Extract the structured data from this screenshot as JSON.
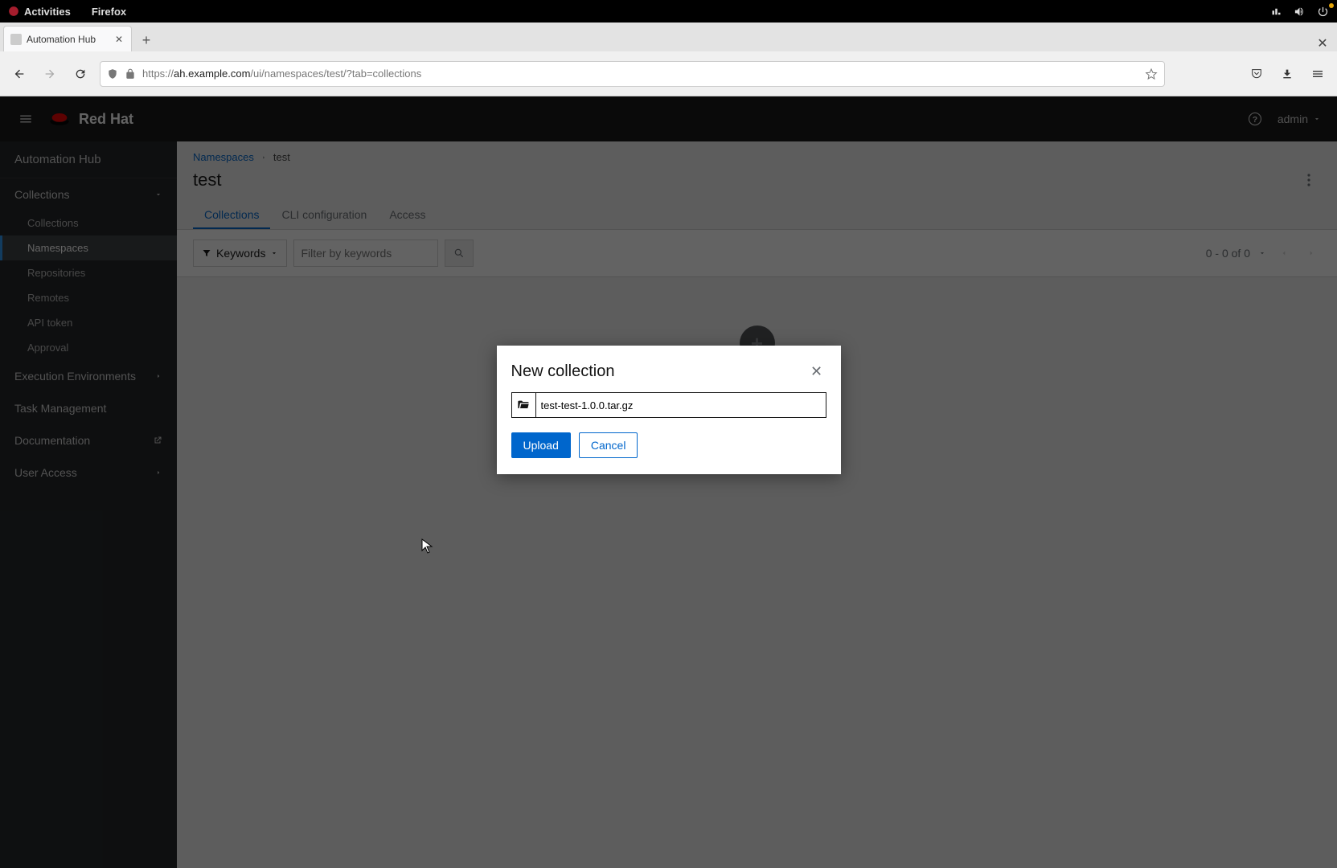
{
  "gnome": {
    "activities": "Activities",
    "app": "Firefox"
  },
  "browser": {
    "tab_title": "Automation Hub",
    "url_prefix": "https://",
    "url_host": "ah.example.com",
    "url_path": "/ui/namespaces/test/?tab=collections"
  },
  "masthead": {
    "brand": "Red Hat",
    "user": "admin"
  },
  "sidebar": {
    "product": "Automation Hub",
    "collections": {
      "label": "Collections",
      "items": [
        "Collections",
        "Namespaces",
        "Repositories",
        "Remotes",
        "API token",
        "Approval"
      ],
      "active_index": 1
    },
    "exec_env": "Execution Environments",
    "task_mgmt": "Task Management",
    "docs": "Documentation",
    "access": "User Access"
  },
  "breadcrumb": {
    "root": "Namespaces",
    "current": "test"
  },
  "page_title": "test",
  "tabs": [
    "Collections",
    "CLI configuration",
    "Access"
  ],
  "toolbar": {
    "filter_type": "Keywords",
    "filter_placeholder": "Filter by keywords",
    "pagination": "0 - 0 of 0"
  },
  "modal": {
    "title": "New collection",
    "filename": "test-test-1.0.0.tar.gz",
    "upload": "Upload",
    "cancel": "Cancel"
  }
}
